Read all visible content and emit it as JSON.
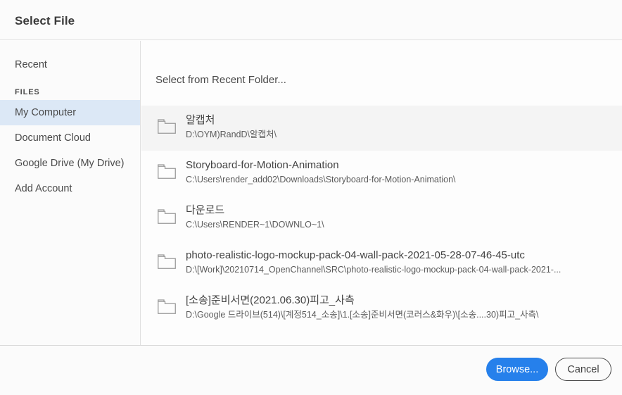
{
  "window": {
    "title": "Select File"
  },
  "sidebar": {
    "recent_label": "Recent",
    "group_label": "FILES",
    "items": [
      {
        "label": "My Computer",
        "selected": true
      },
      {
        "label": "Document Cloud",
        "selected": false
      },
      {
        "label": "Google Drive (My Drive)",
        "selected": false
      },
      {
        "label": "Add Account",
        "selected": false
      }
    ]
  },
  "content": {
    "heading": "Select from Recent Folder...",
    "folder_icon": "folder-icon",
    "files": [
      {
        "name": "알캡처",
        "path": "D:\\OYM)RandD\\알캡처\\",
        "active": true
      },
      {
        "name": "Storyboard-for-Motion-Animation",
        "path": "C:\\Users\\render_add02\\Downloads\\Storyboard-for-Motion-Animation\\",
        "active": false
      },
      {
        "name": "다운로드",
        "path": "C:\\Users\\RENDER~1\\DOWNLO~1\\",
        "active": false
      },
      {
        "name": "photo-realistic-logo-mockup-pack-04-wall-pack-2021-05-28-07-46-45-utc",
        "path": "D:\\[Work]\\20210714_OpenChannel\\SRC\\photo-realistic-logo-mockup-pack-04-wall-pack-2021-...",
        "active": false
      },
      {
        "name": "[소송]준비서면(2021.06.30)피고_사측",
        "path": "D:\\Google 드라이브(514)\\[계정514_소송]\\1.[소송]준비서면(코러스&화우)\\[소송....30)피고_사측\\",
        "active": false
      }
    ]
  },
  "footer": {
    "browse_label": "Browse...",
    "cancel_label": "Cancel"
  },
  "colors": {
    "accent": "#2680eb",
    "selection": "#dce8f6",
    "row_hover": "#f4f4f4"
  }
}
